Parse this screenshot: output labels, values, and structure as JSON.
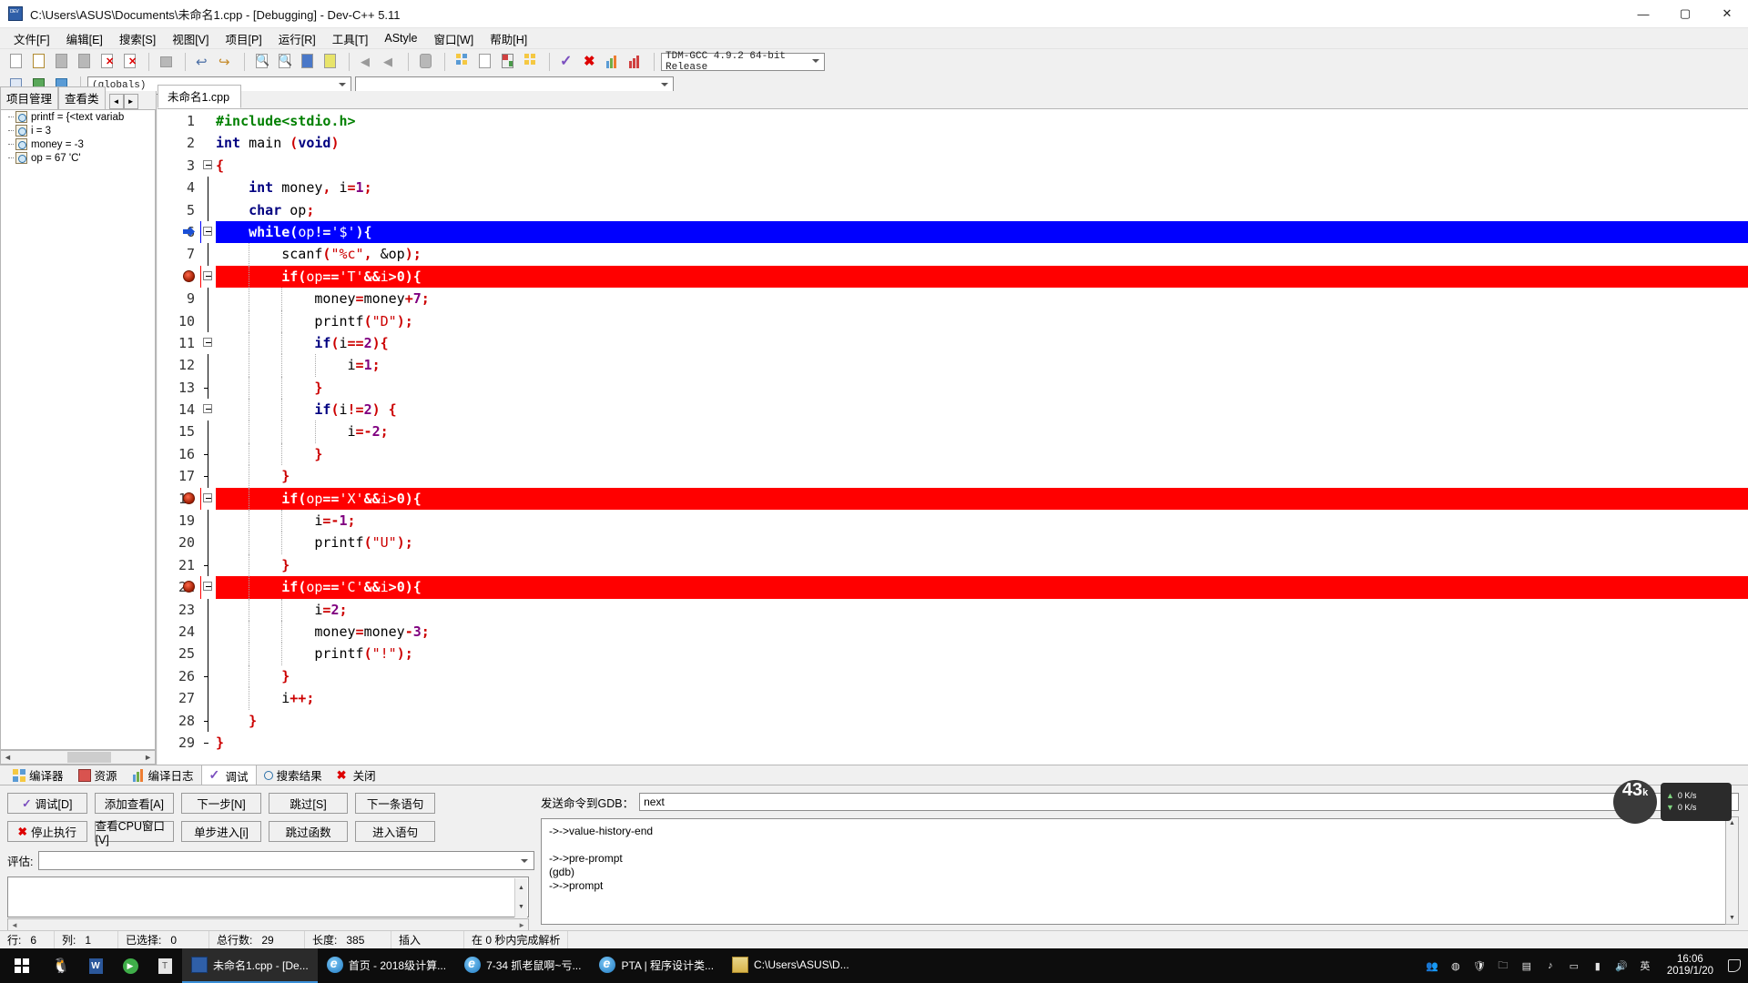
{
  "window": {
    "title": "C:\\Users\\ASUS\\Documents\\未命名1.cpp - [Debugging] - Dev-C++ 5.11",
    "minimize": "—",
    "maximize": "▢",
    "close": "✕"
  },
  "menu": [
    {
      "label": "文件[F]"
    },
    {
      "label": "编辑[E]"
    },
    {
      "label": "搜索[S]"
    },
    {
      "label": "视图[V]"
    },
    {
      "label": "项目[P]"
    },
    {
      "label": "运行[R]"
    },
    {
      "label": "工具[T]"
    },
    {
      "label": "AStyle"
    },
    {
      "label": "窗口[W]"
    },
    {
      "label": "帮助[H]"
    }
  ],
  "toolbar": {
    "compiler_combo": "TDM-GCC 4.9.2 64-bit Release",
    "globals_combo": "(globals)",
    "members_combo": "",
    "icons": [
      "new-file-icon",
      "open-file-icon",
      "save-icon",
      "save-all-icon",
      "close-file-icon",
      "close-all-icon",
      "print-icon",
      "undo-icon",
      "redo-icon",
      "find-icon",
      "replace-icon",
      "goto-line-icon",
      "goto-function-icon",
      "back-icon",
      "forward-icon",
      "toggle-breakpoint-icon",
      "compile-icon",
      "run-icon",
      "compile-run-icon",
      "rebuild-icon",
      "check-syntax-icon",
      "stop-icon",
      "profile-icon",
      "debug-icon"
    ]
  },
  "left_panel": {
    "tabs": [
      {
        "label": "项目管理",
        "active": false
      },
      {
        "label": "查看类",
        "active": false
      }
    ],
    "nav_prev": "◄",
    "nav_next": "►",
    "watches": [
      {
        "text": "printf = {<text variab"
      },
      {
        "text": "i = 3"
      },
      {
        "text": "money = -3"
      },
      {
        "text": "op = 67 'C'"
      }
    ]
  },
  "editor": {
    "tab_label": "未命名1.cpp",
    "lines": [
      {
        "n": 1,
        "fold": false,
        "indent": 0,
        "state": "",
        "tokens": [
          {
            "t": "#include<stdio.h>",
            "c": "pp"
          }
        ]
      },
      {
        "n": 2,
        "fold": false,
        "indent": 0,
        "state": "",
        "tokens": [
          {
            "t": "int",
            "c": "k"
          },
          {
            "t": " main ",
            "c": "id"
          },
          {
            "t": "(",
            "c": "kr"
          },
          {
            "t": "void",
            "c": "k"
          },
          {
            "t": ")",
            "c": "kr"
          }
        ]
      },
      {
        "n": 3,
        "fold": true,
        "indent": 0,
        "state": "",
        "tokens": [
          {
            "t": "{",
            "c": "kr"
          }
        ]
      },
      {
        "n": 4,
        "fold": false,
        "indent": 0,
        "state": "",
        "tokens": [
          {
            "t": "    ",
            "c": "id"
          },
          {
            "t": "int",
            "c": "k"
          },
          {
            "t": " money",
            "c": "id"
          },
          {
            "t": ",",
            "c": "kr"
          },
          {
            "t": " i",
            "c": "id"
          },
          {
            "t": "=",
            "c": "op"
          },
          {
            "t": "1",
            "c": "num"
          },
          {
            "t": ";",
            "c": "kr"
          }
        ]
      },
      {
        "n": 5,
        "fold": false,
        "indent": 0,
        "state": "",
        "tokens": [
          {
            "t": "    ",
            "c": "id"
          },
          {
            "t": "char",
            "c": "k"
          },
          {
            "t": " op",
            "c": "id"
          },
          {
            "t": ";",
            "c": "kr"
          }
        ]
      },
      {
        "n": 6,
        "fold": true,
        "indent": 0,
        "state": "cur",
        "marker": "arrow",
        "tokens": [
          {
            "t": "    ",
            "c": "id"
          },
          {
            "t": "while",
            "c": "k"
          },
          {
            "t": "(",
            "c": "kr"
          },
          {
            "t": "op",
            "c": "id"
          },
          {
            "t": "!=",
            "c": "op"
          },
          {
            "t": "'$'",
            "c": "st"
          },
          {
            "t": "){",
            "c": "kr"
          }
        ]
      },
      {
        "n": 7,
        "fold": false,
        "indent": 1,
        "state": "",
        "tokens": [
          {
            "t": "        ",
            "c": "id"
          },
          {
            "t": "scanf",
            "c": "id"
          },
          {
            "t": "(",
            "c": "kr"
          },
          {
            "t": "\"%c\"",
            "c": "st"
          },
          {
            "t": ",",
            "c": "kr"
          },
          {
            "t": " &op",
            "c": "id"
          },
          {
            "t": ");",
            "c": "kr"
          }
        ]
      },
      {
        "n": 8,
        "fold": true,
        "indent": 1,
        "state": "bp",
        "marker": "bpdot",
        "tokens": [
          {
            "t": "        ",
            "c": "id"
          },
          {
            "t": "if",
            "c": "k"
          },
          {
            "t": "(",
            "c": "kr"
          },
          {
            "t": "op",
            "c": "id"
          },
          {
            "t": "==",
            "c": "op"
          },
          {
            "t": "'T'",
            "c": "st"
          },
          {
            "t": "&&",
            "c": "op"
          },
          {
            "t": "i",
            "c": "id"
          },
          {
            "t": ">",
            "c": "op"
          },
          {
            "t": "0",
            "c": "num"
          },
          {
            "t": "){",
            "c": "kr"
          }
        ]
      },
      {
        "n": 9,
        "fold": false,
        "indent": 2,
        "state": "",
        "tokens": [
          {
            "t": "            money",
            "c": "id"
          },
          {
            "t": "=",
            "c": "op"
          },
          {
            "t": "money",
            "c": "id"
          },
          {
            "t": "+",
            "c": "op"
          },
          {
            "t": "7",
            "c": "num"
          },
          {
            "t": ";",
            "c": "kr"
          }
        ]
      },
      {
        "n": 10,
        "fold": false,
        "indent": 2,
        "state": "",
        "tokens": [
          {
            "t": "            ",
            "c": "id"
          },
          {
            "t": "printf",
            "c": "id"
          },
          {
            "t": "(",
            "c": "kr"
          },
          {
            "t": "\"D\"",
            "c": "st"
          },
          {
            "t": ");",
            "c": "kr"
          }
        ]
      },
      {
        "n": 11,
        "fold": true,
        "indent": 2,
        "state": "",
        "tokens": [
          {
            "t": "            ",
            "c": "id"
          },
          {
            "t": "if",
            "c": "k"
          },
          {
            "t": "(",
            "c": "kr"
          },
          {
            "t": "i",
            "c": "id"
          },
          {
            "t": "==",
            "c": "op"
          },
          {
            "t": "2",
            "c": "num"
          },
          {
            "t": "){",
            "c": "kr"
          }
        ]
      },
      {
        "n": 12,
        "fold": false,
        "indent": 3,
        "state": "",
        "tokens": [
          {
            "t": "                i",
            "c": "id"
          },
          {
            "t": "=",
            "c": "op"
          },
          {
            "t": "1",
            "c": "num"
          },
          {
            "t": ";",
            "c": "kr"
          }
        ]
      },
      {
        "n": 13,
        "fold": false,
        "indent": 2,
        "state": "",
        "tokens": [
          {
            "t": "            ",
            "c": "id"
          },
          {
            "t": "}",
            "c": "kr"
          }
        ]
      },
      {
        "n": 14,
        "fold": true,
        "indent": 2,
        "state": "",
        "tokens": [
          {
            "t": "            ",
            "c": "id"
          },
          {
            "t": "if",
            "c": "k"
          },
          {
            "t": "(",
            "c": "kr"
          },
          {
            "t": "i",
            "c": "id"
          },
          {
            "t": "!=",
            "c": "op"
          },
          {
            "t": "2",
            "c": "num"
          },
          {
            "t": ") ",
            "c": "kr"
          },
          {
            "t": "{",
            "c": "kr"
          }
        ]
      },
      {
        "n": 15,
        "fold": false,
        "indent": 3,
        "state": "",
        "tokens": [
          {
            "t": "                i",
            "c": "id"
          },
          {
            "t": "=-",
            "c": "op"
          },
          {
            "t": "2",
            "c": "num"
          },
          {
            "t": ";",
            "c": "kr"
          }
        ]
      },
      {
        "n": 16,
        "fold": false,
        "indent": 2,
        "state": "",
        "tokens": [
          {
            "t": "            ",
            "c": "id"
          },
          {
            "t": "}",
            "c": "kr"
          }
        ]
      },
      {
        "n": 17,
        "fold": false,
        "indent": 1,
        "state": "",
        "tokens": [
          {
            "t": "        ",
            "c": "id"
          },
          {
            "t": "}",
            "c": "kr"
          }
        ]
      },
      {
        "n": 18,
        "fold": true,
        "indent": 1,
        "state": "bp",
        "marker": "bpdot",
        "tokens": [
          {
            "t": "        ",
            "c": "id"
          },
          {
            "t": "if",
            "c": "k"
          },
          {
            "t": "(",
            "c": "kr"
          },
          {
            "t": "op",
            "c": "id"
          },
          {
            "t": "==",
            "c": "op"
          },
          {
            "t": "'X'",
            "c": "st"
          },
          {
            "t": "&&",
            "c": "op"
          },
          {
            "t": "i",
            "c": "id"
          },
          {
            "t": ">",
            "c": "op"
          },
          {
            "t": "0",
            "c": "num"
          },
          {
            "t": "){",
            "c": "kr"
          }
        ]
      },
      {
        "n": 19,
        "fold": false,
        "indent": 2,
        "state": "",
        "tokens": [
          {
            "t": "            i",
            "c": "id"
          },
          {
            "t": "=-",
            "c": "op"
          },
          {
            "t": "1",
            "c": "num"
          },
          {
            "t": ";",
            "c": "kr"
          }
        ]
      },
      {
        "n": 20,
        "fold": false,
        "indent": 2,
        "state": "",
        "tokens": [
          {
            "t": "            ",
            "c": "id"
          },
          {
            "t": "printf",
            "c": "id"
          },
          {
            "t": "(",
            "c": "kr"
          },
          {
            "t": "\"U\"",
            "c": "st"
          },
          {
            "t": ");",
            "c": "kr"
          }
        ]
      },
      {
        "n": 21,
        "fold": false,
        "indent": 1,
        "state": "",
        "tokens": [
          {
            "t": "        ",
            "c": "id"
          },
          {
            "t": "}",
            "c": "kr"
          }
        ]
      },
      {
        "n": 22,
        "fold": true,
        "indent": 1,
        "state": "bp",
        "marker": "bpdot",
        "tokens": [
          {
            "t": "        ",
            "c": "id"
          },
          {
            "t": "if",
            "c": "k"
          },
          {
            "t": "(",
            "c": "kr"
          },
          {
            "t": "op",
            "c": "id"
          },
          {
            "t": "==",
            "c": "op"
          },
          {
            "t": "'C'",
            "c": "st"
          },
          {
            "t": "&&",
            "c": "op"
          },
          {
            "t": "i",
            "c": "id"
          },
          {
            "t": ">",
            "c": "op"
          },
          {
            "t": "0",
            "c": "num"
          },
          {
            "t": "){",
            "c": "kr"
          }
        ]
      },
      {
        "n": 23,
        "fold": false,
        "indent": 2,
        "state": "",
        "tokens": [
          {
            "t": "            i",
            "c": "id"
          },
          {
            "t": "=",
            "c": "op"
          },
          {
            "t": "2",
            "c": "num"
          },
          {
            "t": ";",
            "c": "kr"
          }
        ]
      },
      {
        "n": 24,
        "fold": false,
        "indent": 2,
        "state": "",
        "tokens": [
          {
            "t": "            money",
            "c": "id"
          },
          {
            "t": "=",
            "c": "op"
          },
          {
            "t": "money",
            "c": "id"
          },
          {
            "t": "-",
            "c": "op"
          },
          {
            "t": "3",
            "c": "num"
          },
          {
            "t": ";",
            "c": "kr"
          }
        ]
      },
      {
        "n": 25,
        "fold": false,
        "indent": 2,
        "state": "",
        "tokens": [
          {
            "t": "            ",
            "c": "id"
          },
          {
            "t": "printf",
            "c": "id"
          },
          {
            "t": "(",
            "c": "kr"
          },
          {
            "t": "\"!\"",
            "c": "st"
          },
          {
            "t": ");",
            "c": "kr"
          }
        ]
      },
      {
        "n": 26,
        "fold": false,
        "indent": 1,
        "state": "",
        "tokens": [
          {
            "t": "        ",
            "c": "id"
          },
          {
            "t": "}",
            "c": "kr"
          }
        ]
      },
      {
        "n": 27,
        "fold": false,
        "indent": 1,
        "state": "",
        "tokens": [
          {
            "t": "        i",
            "c": "id"
          },
          {
            "t": "++",
            "c": "op"
          },
          {
            "t": ";",
            "c": "kr"
          }
        ]
      },
      {
        "n": 28,
        "fold": false,
        "indent": 0,
        "state": "",
        "tokens": [
          {
            "t": "    ",
            "c": "id"
          },
          {
            "t": "}",
            "c": "kr"
          }
        ]
      },
      {
        "n": 29,
        "fold": false,
        "indent": 0,
        "state": "",
        "tokens": [
          {
            "t": "}",
            "c": "kr"
          }
        ]
      }
    ]
  },
  "bottom": {
    "tabs": [
      {
        "label": "编译器",
        "icon": "grid-icon",
        "active": false
      },
      {
        "label": "资源",
        "icon": "resource-icon",
        "active": false
      },
      {
        "label": "编译日志",
        "icon": "log-chart-icon",
        "active": false
      },
      {
        "label": "调试",
        "icon": "check-icon",
        "active": true
      },
      {
        "label": "搜索结果",
        "icon": "magnifier-icon",
        "active": false
      },
      {
        "label": "关闭",
        "icon": "close-x-icon",
        "active": false
      }
    ],
    "debug_buttons_row1": [
      {
        "label": "调试[D]",
        "icon": "check-icon"
      },
      {
        "label": "添加查看[A]",
        "icon": ""
      },
      {
        "label": "下一步[N]",
        "icon": ""
      },
      {
        "label": "跳过[S]",
        "icon": ""
      },
      {
        "label": "下一条语句",
        "icon": ""
      }
    ],
    "debug_buttons_row2": [
      {
        "label": "停止执行",
        "icon": "red-x-icon"
      },
      {
        "label": "查看CPU窗口[V]",
        "icon": ""
      },
      {
        "label": "单步进入[i]",
        "icon": ""
      },
      {
        "label": "跳过函数",
        "icon": ""
      },
      {
        "label": "进入语句",
        "icon": ""
      }
    ],
    "eval_label": "评估:",
    "eval_value": "",
    "gdb_label": "发送命令到GDB：",
    "gdb_command": "next",
    "gdb_output": [
      "->->value-history-end",
      "",
      "->->pre-prompt",
      "(gdb)",
      "->->prompt"
    ]
  },
  "statusbar": [
    {
      "label": "行:",
      "value": "6"
    },
    {
      "label": "列:",
      "value": "1"
    },
    {
      "label": "已选择:",
      "value": "0"
    },
    {
      "label": "总行数:",
      "value": "29"
    },
    {
      "label": "长度:",
      "value": "385"
    },
    {
      "label": "插入",
      "value": ""
    },
    {
      "label": "在 0 秒内完成解析",
      "value": ""
    }
  ],
  "speed_widget": {
    "value": "43",
    "unit": "k",
    "up": "0 K/s",
    "down": "0 K/s"
  },
  "taskbar": {
    "start_icon": "windows-logo-icon",
    "quick_launch": [
      {
        "name": "qq-icon"
      },
      {
        "name": "word-icon"
      },
      {
        "name": "media-player-icon"
      },
      {
        "name": "thunder-icon"
      }
    ],
    "items": [
      {
        "label": "未命名1.cpp - [De...",
        "icon": "devcpp-icon",
        "active": true
      },
      {
        "label": "首页 - 2018级计算...",
        "icon": "ie-icon",
        "active": false
      },
      {
        "label": "7-34 抓老鼠啊~亏...",
        "icon": "ie-icon",
        "active": false
      },
      {
        "label": "PTA | 程序设计类...",
        "icon": "ie-icon",
        "active": false
      },
      {
        "label": "C:\\Users\\ASUS\\D...",
        "icon": "explorer-icon",
        "active": false
      }
    ],
    "tray": {
      "icons": [
        "people-icon",
        "chrome-icon",
        "shield-icon",
        "folder-icon",
        "net-icon",
        "music-icon",
        "monitor-icon",
        "battery-icon",
        "volume-icon"
      ],
      "ime": "英",
      "time": "16:06",
      "date": "2019/1/20"
    }
  },
  "colors": {
    "current_line": "#0000ff",
    "breakpoint_line": "#ff0000",
    "keyword": "#000080",
    "string": "#cc0000",
    "preprocessor": "#008000",
    "number": "#800080",
    "taskbar_accent": "#3a8fd8"
  }
}
